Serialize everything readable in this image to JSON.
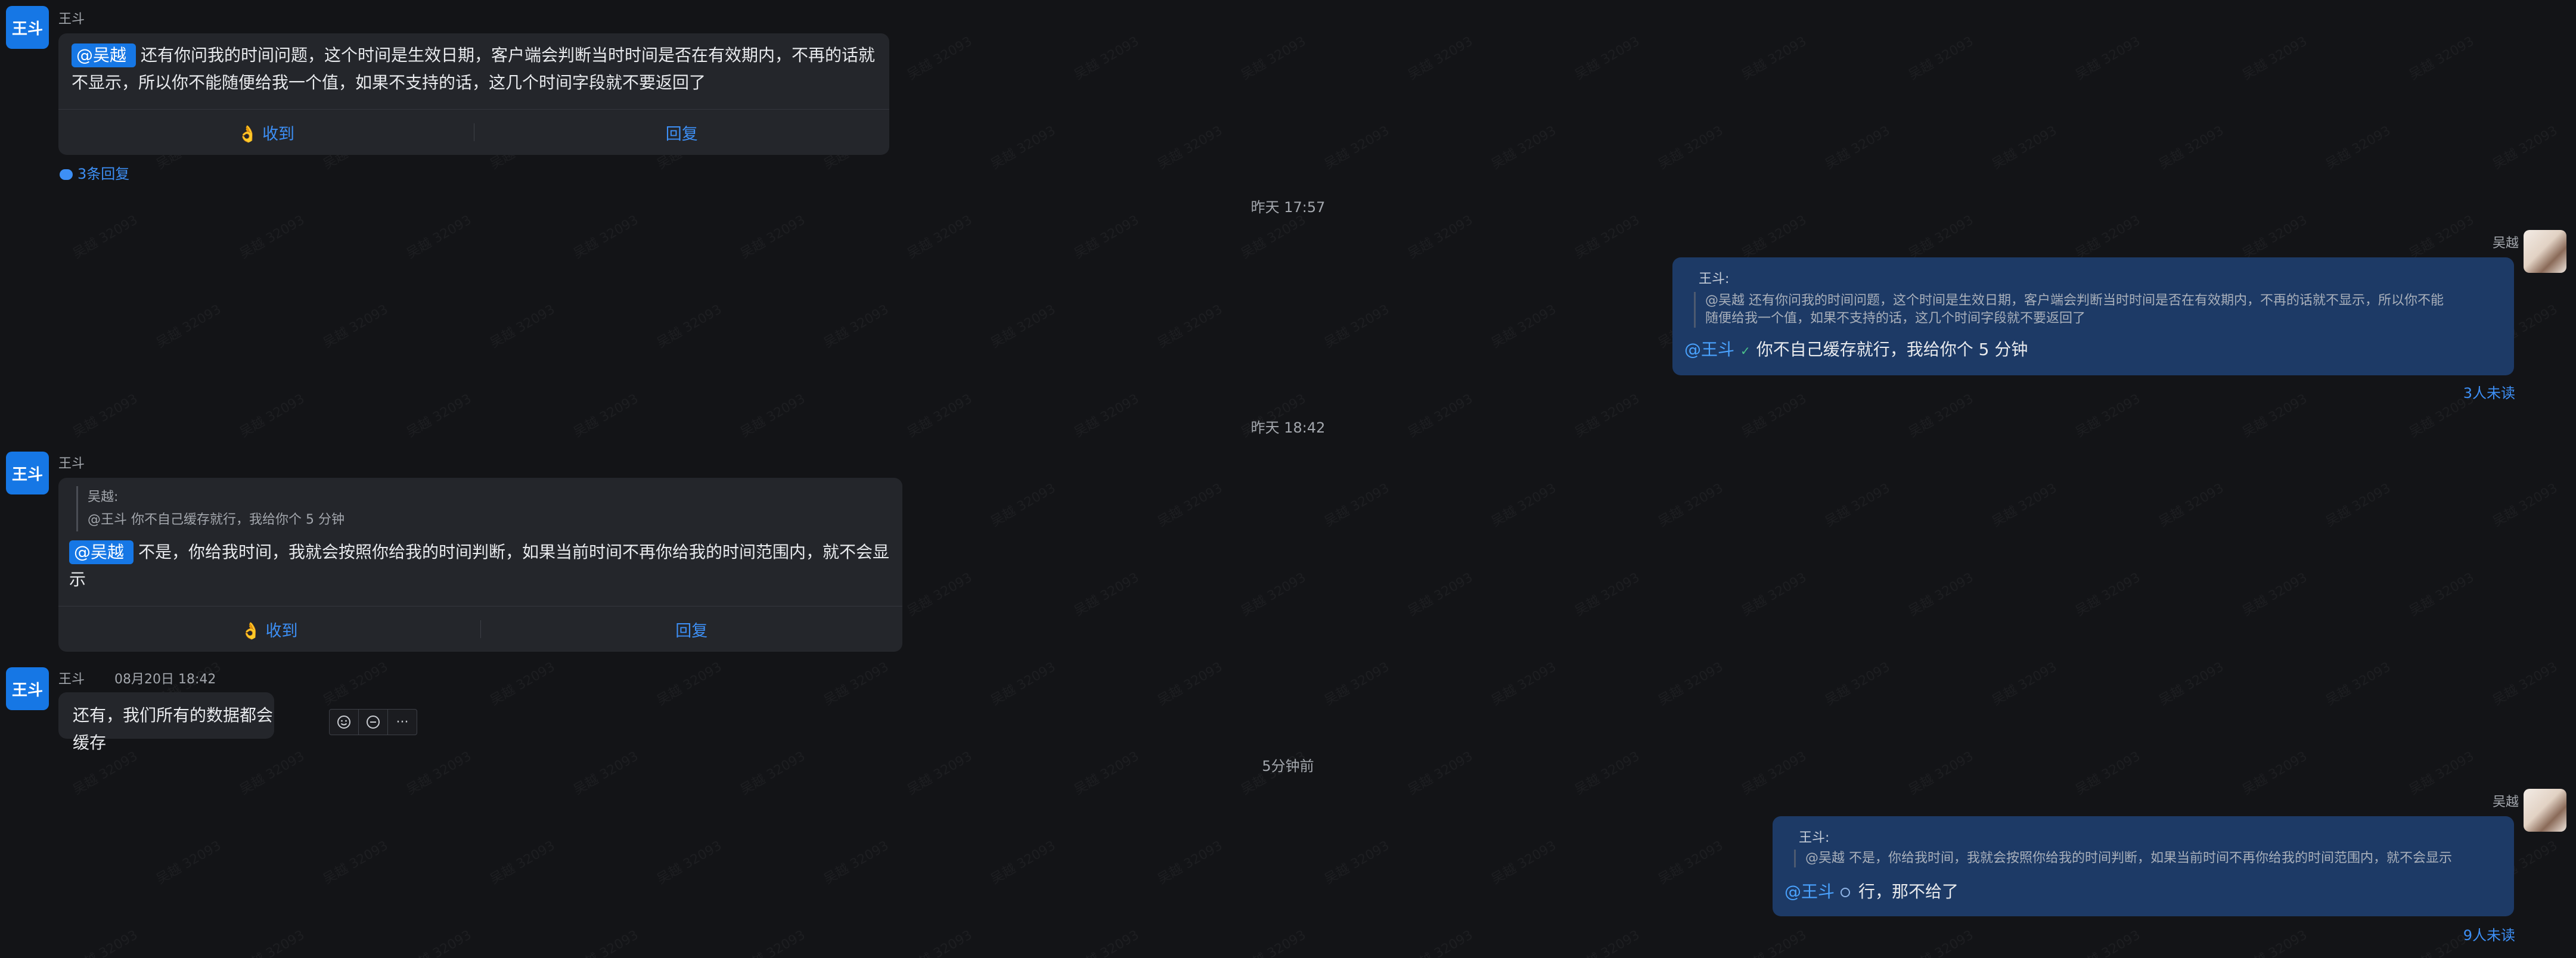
{
  "watermark": "吴越 32093",
  "messages": [
    {
      "sender": "王斗",
      "avatar_text": "王斗",
      "mention": "@吴越",
      "text_line1": "还有你问我的时间问题，这个时间是生效日期，客户端会判断当时时间是否在有效期内，不再的话就",
      "text_line2": "不显示，所以你不能随便给我一个值，如果不支持的话，这几个时间字段就不要返回了",
      "ack_label": "收到",
      "reply_label": "回复",
      "replies_link": "3条回复"
    },
    {
      "time_divider": "昨天 17:57",
      "sender": "吴越",
      "quote_author": "王斗:",
      "quote_line1": "@吴越  还有你问我的时间问题，这个时间是生效日期，客户端会判断当时时间是否在有效期内，不再的话就不显示，所以你不能",
      "quote_line2": "随便给我一个值，如果不支持的话，这几个时间字段就不要返回了",
      "mention": "@王斗",
      "text": "你不自己缓存就行，我给你个 5 分钟",
      "read_status": "3人未读"
    },
    {
      "time_divider": "昨天 18:42",
      "sender": "王斗",
      "avatar_text": "王斗",
      "quote_author": "吴越:",
      "quote_text": "@王斗 你不自己缓存就行，我给你个 5 分钟",
      "mention": "@吴越",
      "text_line1": "不是，你给我时间，我就会按照你给我的时间判断，如果当前时间不再你给我的时间范围内，就不会显",
      "text_line2": "示",
      "ack_label": "收到",
      "reply_label": "回复"
    },
    {
      "sender": "王斗",
      "avatar_text": "王斗",
      "timestamp": "08月20日 18:42",
      "text": "还有，我们所有的数据都会缓存",
      "toolbar_more": "···"
    },
    {
      "time_divider": "5分钟前",
      "sender": "吴越",
      "quote_author": "王斗:",
      "quote_text": "@吴越  不是，你给我时间，我就会按照你给我的时间判断，如果当前时间不再你给我的时间范围内，就不会显示",
      "mention": "@王斗",
      "text": "行，那不给了",
      "read_status": "9人未读"
    }
  ],
  "colors": {
    "background": "#131417",
    "bubble_left": "#24262b",
    "bubble_right": "#1d3a66",
    "accent": "#1677e5",
    "link": "#3d8ff5"
  }
}
